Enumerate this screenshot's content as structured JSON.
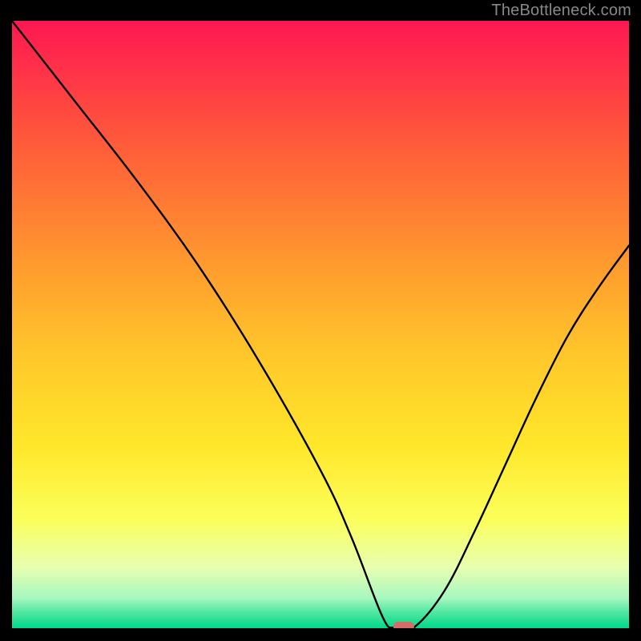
{
  "watermark": "TheBottleneck.com",
  "chart_data": {
    "type": "line",
    "title": "",
    "xlabel": "",
    "ylabel": "",
    "xlim": [
      0,
      100
    ],
    "ylim": [
      0,
      100
    ],
    "x": [
      0,
      10,
      20,
      30,
      40,
      50,
      55,
      60,
      62,
      65,
      70,
      75,
      80,
      85,
      90,
      95,
      100
    ],
    "values": [
      100,
      87,
      74,
      60,
      44,
      26,
      15,
      2,
      0,
      0,
      6,
      16,
      27,
      38,
      48,
      56,
      63
    ],
    "marker": {
      "x": 63.5,
      "y": 0,
      "color": "#d96a6a"
    },
    "gradient_stops": [
      {
        "offset": 0.0,
        "color": "#ff1752"
      },
      {
        "offset": 0.2,
        "color": "#ff5a3a"
      },
      {
        "offset": 0.4,
        "color": "#ff9a2e"
      },
      {
        "offset": 0.55,
        "color": "#ffc72a"
      },
      {
        "offset": 0.7,
        "color": "#ffe72a"
      },
      {
        "offset": 0.82,
        "color": "#fbff5a"
      },
      {
        "offset": 0.9,
        "color": "#e8ffb0"
      },
      {
        "offset": 0.95,
        "color": "#a8f7c0"
      },
      {
        "offset": 0.975,
        "color": "#4de6a0"
      },
      {
        "offset": 1.0,
        "color": "#00d98a"
      }
    ]
  }
}
